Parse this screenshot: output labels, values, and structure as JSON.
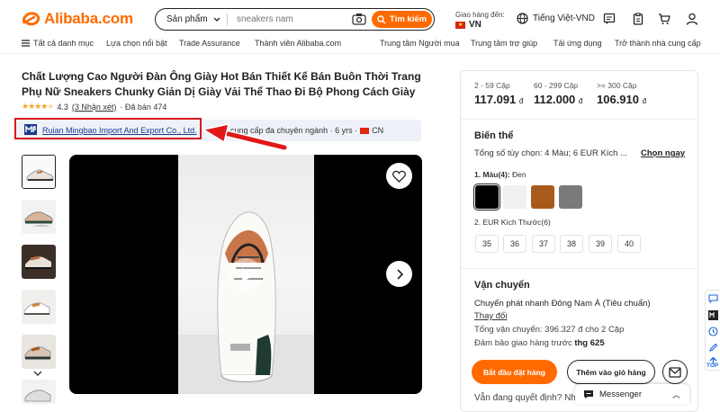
{
  "header": {
    "logo_text": "Alibaba.com",
    "search": {
      "category": "Sản phẩm",
      "placeholder": "sneakers nam",
      "button_label": "Tìm kiếm"
    },
    "deliver_to": {
      "label": "Giao hàng đến:",
      "country": "VN"
    },
    "language": "Tiếng Việt-VND",
    "icons": [
      "message-icon",
      "orders-icon",
      "cart-icon",
      "account-icon"
    ]
  },
  "nav": {
    "all_categories": "Tất cả danh mục",
    "items": [
      "Lựa chọn nổi bật",
      "Trade Assurance",
      "Thành viên Alibaba.com",
      "Trung tâm Người mua",
      "Trung tâm trợ giúp",
      "Tải ứng dụng",
      "Trở thành nhà cung cấp"
    ]
  },
  "product": {
    "title": "Chất Lượng Cao Người Đàn Ông Giày Hot Bán Thiết Kế Bán Buôn Thời Trang Phụ Nữ Sneakers Chunky Giản Dị Giày Vải Thể Thao Đi Bộ Phong Cách Giày",
    "rating_value": "4.3",
    "rating_count": "(3 Nhận xét)",
    "sold": "· Đã bán 474",
    "rating_fraction": 0.86
  },
  "supplier": {
    "name": "Ruian Mingbao Import And Export Co., Ltd.",
    "info": "cung cấp đa chuyên ngành · 6 yrs ·",
    "country": "CN"
  },
  "pricing": {
    "tiers": [
      {
        "range": "2 - 59 Cặp",
        "price": "117.091",
        "currency": "đ"
      },
      {
        "range": "60 - 299 Cặp",
        "price": "112.000",
        "currency": "đ"
      },
      {
        "range": ">= 300 Cặp",
        "price": "106.910",
        "currency": "đ"
      }
    ]
  },
  "variants": {
    "title": "Biến thể",
    "summary": "Tổng số tùy chọn: 4 Màu; 6 EUR Kích ...",
    "choose_link": "Chọn ngay",
    "color_label": "1. Màu(4):",
    "color_selected": "Đen",
    "colors": [
      "#000000",
      "#f0f0f0",
      "#a85a1c",
      "#7a7a7a"
    ],
    "size_label": "2. EUR Kích Thước(6)",
    "sizes": [
      "35",
      "36",
      "37",
      "38",
      "39",
      "40"
    ]
  },
  "shipping": {
    "title": "Vận chuyển",
    "method": "Chuyển phát nhanh Đông Nam Á (Tiêu chuẩn)",
    "change": "Thay đổi",
    "total": "Tổng vận chuyển: 396.327 đ cho 2 Cặp",
    "guarantee_prefix": "Đảm bảo giao hàng trước",
    "guarantee_date": "thg 625"
  },
  "actions": {
    "order": "Bắt đầu đặt hàng",
    "cart": "Thêm vào giỏ hàng",
    "question": "Vẫn đang quyết định? Nhận m..."
  },
  "messenger": {
    "label": "Messenger"
  },
  "sidebar": {
    "top_label": "TOP"
  },
  "colors": {
    "accent": "#ff6a00",
    "highlight_box": "#d91a1a",
    "link": "#1a3c8c"
  }
}
